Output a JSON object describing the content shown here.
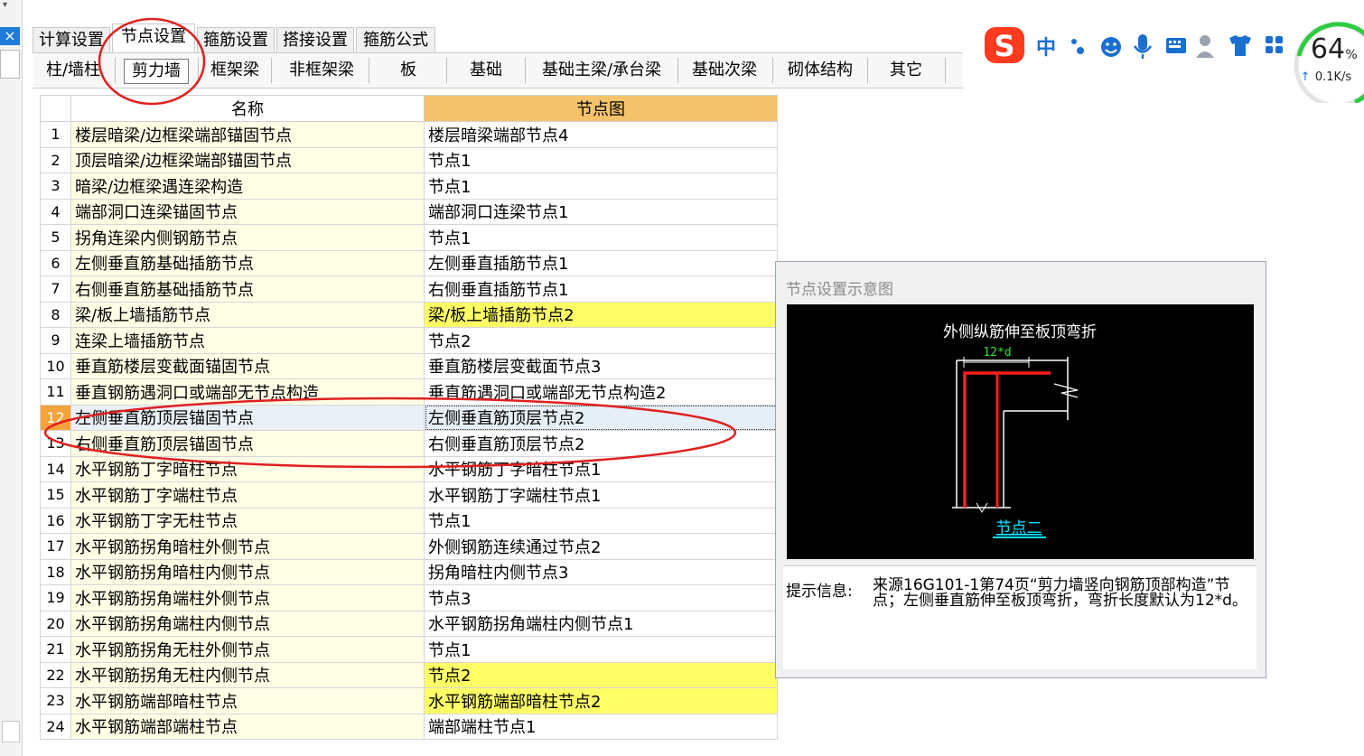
{
  "left_strip": {
    "close": "×",
    "dropdown": "▾"
  },
  "main_tabs": [
    {
      "label": "计算设置",
      "active": false
    },
    {
      "label": "节点设置",
      "active": true
    },
    {
      "label": "箍筋设置",
      "active": false
    },
    {
      "label": "搭接设置",
      "active": false
    },
    {
      "label": "箍筋公式",
      "active": false
    }
  ],
  "sub_tabs": [
    {
      "label": "柱/墙柱",
      "active": false
    },
    {
      "label": "剪力墙",
      "active": true
    },
    {
      "label": "框架梁",
      "active": false
    },
    {
      "label": "非框架梁",
      "active": false
    },
    {
      "label": "板",
      "active": false
    },
    {
      "label": "基础",
      "active": false
    },
    {
      "label": "基础主梁/承台梁",
      "active": false
    },
    {
      "label": "基础次梁",
      "active": false
    },
    {
      "label": "砌体结构",
      "active": false
    },
    {
      "label": "其它",
      "active": false
    }
  ],
  "table": {
    "headers": {
      "name": "名称",
      "node": "节点图"
    },
    "rows": [
      {
        "num": "1",
        "name": "楼层暗梁/边框梁端部锚固节点",
        "node": "楼层暗梁端部节点4",
        "highlight": false
      },
      {
        "num": "2",
        "name": "顶层暗梁/边框梁端部锚固节点",
        "node": "节点1",
        "highlight": false
      },
      {
        "num": "3",
        "name": "暗梁/边框梁遇连梁构造",
        "node": "节点1",
        "highlight": false
      },
      {
        "num": "4",
        "name": "端部洞口连梁锚固节点",
        "node": "端部洞口连梁节点1",
        "highlight": false
      },
      {
        "num": "5",
        "name": "拐角连梁内侧钢筋节点",
        "node": "节点1",
        "highlight": false
      },
      {
        "num": "6",
        "name": "左侧垂直筋基础插筋节点",
        "node": "左侧垂直插筋节点1",
        "highlight": false
      },
      {
        "num": "7",
        "name": "右侧垂直筋基础插筋节点",
        "node": "右侧垂直插筋节点1",
        "highlight": false
      },
      {
        "num": "8",
        "name": "梁/板上墙插筋节点",
        "node": "梁/板上墙插筋节点2",
        "highlight": true
      },
      {
        "num": "9",
        "name": "连梁上墙插筋节点",
        "node": "节点2",
        "highlight": false
      },
      {
        "num": "10",
        "name": "垂直筋楼层变截面锚固节点",
        "node": "垂直筋楼层变截面节点3",
        "highlight": false
      },
      {
        "num": "11",
        "name": "垂直钢筋遇洞口或端部无节点构造",
        "node": "垂直筋遇洞口或端部无节点构造2",
        "highlight": false
      },
      {
        "num": "12",
        "name": "左侧垂直筋顶层锚固节点",
        "node": "左侧垂直筋顶层节点2",
        "highlight": false,
        "selected": true
      },
      {
        "num": "13",
        "name": "右侧垂直筋顶层锚固节点",
        "node": "右侧垂直筋顶层节点2",
        "highlight": false
      },
      {
        "num": "14",
        "name": "水平钢筋丁字暗柱节点",
        "node": "水平钢筋丁字暗柱节点1",
        "highlight": false
      },
      {
        "num": "15",
        "name": "水平钢筋丁字端柱节点",
        "node": "水平钢筋丁字端柱节点1",
        "highlight": false
      },
      {
        "num": "16",
        "name": "水平钢筋丁字无柱节点",
        "node": "节点1",
        "highlight": false
      },
      {
        "num": "17",
        "name": "水平钢筋拐角暗柱外侧节点",
        "node": "外侧钢筋连续通过节点2",
        "highlight": false
      },
      {
        "num": "18",
        "name": "水平钢筋拐角暗柱内侧节点",
        "node": "拐角暗柱内侧节点3",
        "highlight": false
      },
      {
        "num": "19",
        "name": "水平钢筋拐角端柱外侧节点",
        "node": "节点3",
        "highlight": false
      },
      {
        "num": "20",
        "name": "水平钢筋拐角端柱内侧节点",
        "node": "水平钢筋拐角端柱内侧节点1",
        "highlight": false
      },
      {
        "num": "21",
        "name": "水平钢筋拐角无柱外侧节点",
        "node": "节点1",
        "highlight": false
      },
      {
        "num": "22",
        "name": "水平钢筋拐角无柱内侧节点",
        "node": "节点2",
        "highlight": true
      },
      {
        "num": "23",
        "name": "水平钢筋端部暗柱节点",
        "node": "水平钢筋端部暗柱节点2",
        "highlight": true
      },
      {
        "num": "24",
        "name": "水平钢筋端部端柱节点",
        "node": "端部端柱节点1",
        "highlight": false
      }
    ]
  },
  "diagram": {
    "panel_title": "节点设置示意图",
    "caption": "外侧纵筋伸至板顶弯折",
    "dimension": "12*d",
    "node_label": "节点二",
    "hint_label": "提示信息:",
    "hint_text": "来源16G101-1第74页“剪力墙竖向钢筋顶部构造”节点；左侧垂直筋伸至板顶弯折，弯折长度默认为12*d。"
  },
  "ime": {
    "icons": [
      "sogou-logo-icon",
      "chinese-mode-icon",
      "punctuation-icon",
      "emoji-icon",
      "microphone-icon",
      "keyboard-icon",
      "user-icon",
      "skin-icon",
      "toolbox-icon"
    ],
    "mode_char": "中"
  },
  "speed": {
    "percent": "64",
    "unit": "%",
    "rate": "0.1K/s",
    "up_arrow": "↑"
  },
  "colors": {
    "accent_orange": "#f3a33b",
    "highlight_yellow": "#ffff66",
    "name_bg": "#ffffe6",
    "gauge_green": "#2ecc40",
    "annotation_red": "#e02020",
    "ime_blue": "#1a6fd1",
    "sogou_red": "#ff3b1f"
  }
}
